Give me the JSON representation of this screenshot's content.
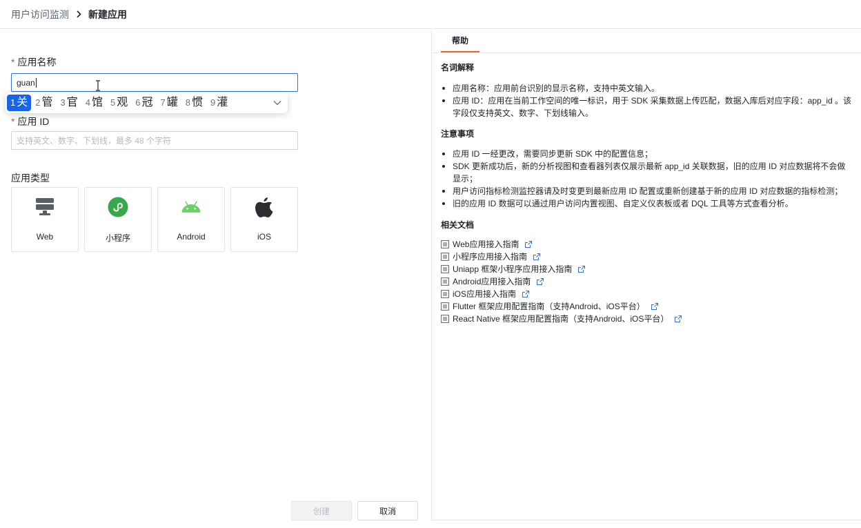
{
  "breadcrumb": {
    "parent": "用户访问监测",
    "current": "新建应用"
  },
  "form": {
    "app_name_label": "应用名称",
    "app_name_value": "guan",
    "app_id_label": "应用 ID",
    "app_id_placeholder": "支持英文、数字、下划线，最多 48 个字符",
    "app_type_label": "应用类型",
    "types": [
      "Web",
      "小程序",
      "Android",
      "iOS"
    ],
    "required_mark": "*"
  },
  "ime": {
    "candidates": [
      {
        "num": "1",
        "char": "关"
      },
      {
        "num": "2",
        "char": "管"
      },
      {
        "num": "3",
        "char": "官"
      },
      {
        "num": "4",
        "char": "馆"
      },
      {
        "num": "5",
        "char": "观"
      },
      {
        "num": "6",
        "char": "冠"
      },
      {
        "num": "7",
        "char": "罐"
      },
      {
        "num": "8",
        "char": "惯"
      },
      {
        "num": "9",
        "char": "灌"
      }
    ]
  },
  "buttons": {
    "create": "创建",
    "cancel": "取消"
  },
  "help": {
    "tab": "帮助",
    "glossary_title": "名词解释",
    "glossary": [
      "应用名称：应用前台识别的显示名称，支持中英文输入。",
      "应用 ID：应用在当前工作空间的唯一标识，用于 SDK 采集数据上传匹配，数据入库后对应字段：app_id 。该字段仅支持英文、数字、下划线输入。"
    ],
    "notes_title": "注意事项",
    "notes": [
      "应用 ID 一经更改，需要同步更新 SDK 中的配置信息；",
      "SDK 更新成功后，新的分析视图和查看器列表仅展示最新 app_id 关联数据，旧的应用 ID 对应数据将不会做显示；",
      "用户访问指标检测监控器请及时变更到最新应用 ID 配置或重新创建基于新的应用 ID 对应数据的指标检测；",
      "旧的应用 ID 数据可以通过用户访问内置视图、自定义仪表板或者 DQL 工具等方式查看分析。"
    ],
    "docs_title": "相关文档",
    "docs": [
      "Web应用接入指南",
      "小程序应用接入指南",
      "Uniapp 框架小程序应用接入指南",
      "Android应用接入指南",
      "iOS应用接入指南",
      "Flutter 框架应用配置指南（支持Android、iOS平台）",
      "React Native 框架应用配置指南（支持Android、iOS平台）"
    ]
  },
  "colors": {
    "accent_tab": "#e8662a",
    "ime_selected": "#1764e8",
    "link_icon": "#2f6fd6",
    "required": "#e5484d",
    "android": "#6ad06a",
    "miniprogram": "#39a84a"
  }
}
